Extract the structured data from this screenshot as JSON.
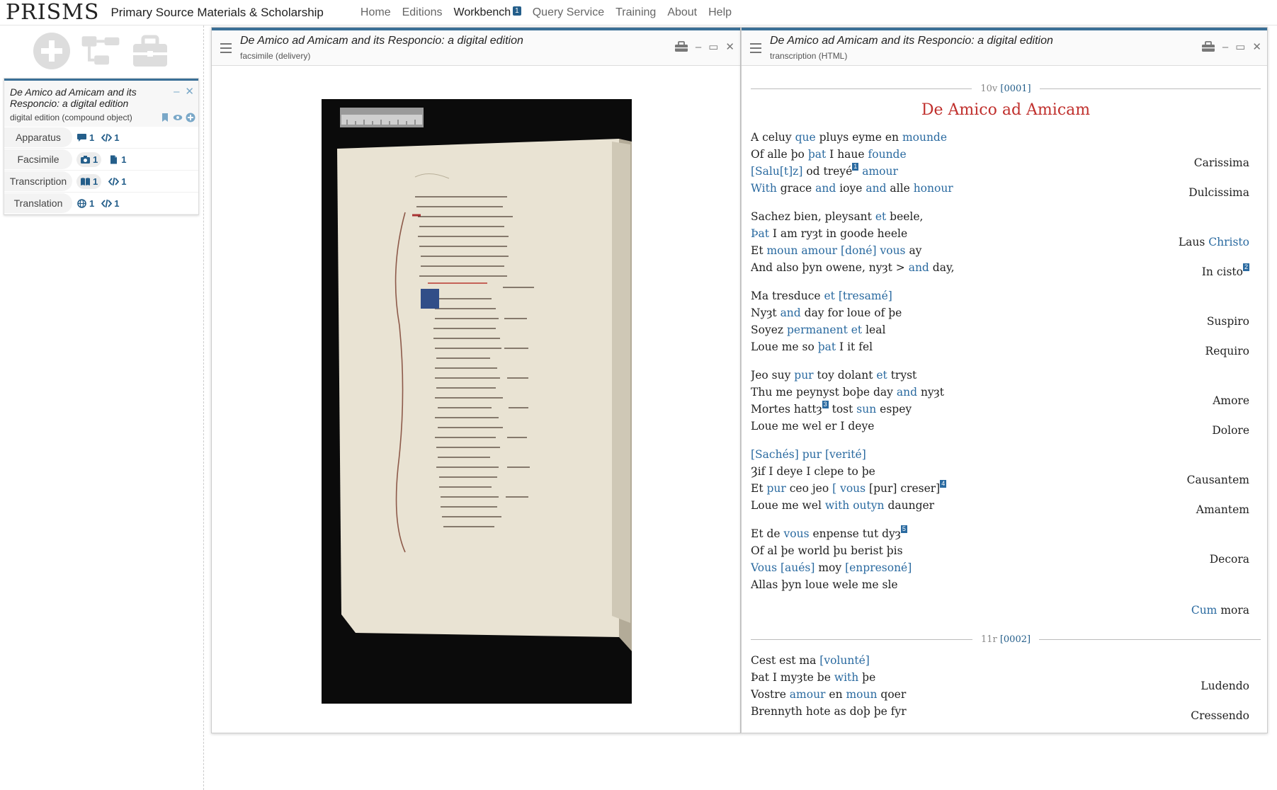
{
  "brand": {
    "logo": "PRISMS",
    "tagline": "Primary Source Materials & Scholarship"
  },
  "nav": [
    {
      "label": "Home",
      "active": false
    },
    {
      "label": "Editions",
      "active": false
    },
    {
      "label": "Workbench",
      "active": true,
      "badge": "1"
    },
    {
      "label": "Query Service",
      "active": false
    },
    {
      "label": "Training",
      "active": false
    },
    {
      "label": "About",
      "active": false
    },
    {
      "label": "Help",
      "active": false
    }
  ],
  "tools": [
    "add-icon",
    "tree-icon",
    "toolbox-icon"
  ],
  "object_card": {
    "title": "De Amico ad Amicam and its Responcio: a digital edition",
    "subtitle": "digital edition (compound object)",
    "components": [
      {
        "label": "Apparatus",
        "a": "1",
        "b": "1",
        "icon_a": "comment-icon",
        "icon_b": "code-icon"
      },
      {
        "label": "Facsimile",
        "a": "1",
        "b": "1",
        "icon_a": "camera-icon",
        "icon_b": "file-icon"
      },
      {
        "label": "Transcription",
        "a": "1",
        "b": "1",
        "icon_a": "book-icon",
        "icon_b": "code-icon"
      },
      {
        "label": "Translation",
        "a": "1",
        "b": "1",
        "icon_a": "globe-icon",
        "icon_b": "code-icon"
      }
    ]
  },
  "windows": {
    "facsimile": {
      "title": "De Amico ad Amicam and its Responcio: a digital edition",
      "subtitle": "facsimile (delivery)"
    },
    "transcription": {
      "title": "De Amico ad Amicam and its Responcio: a digital edition",
      "subtitle": "transcription (HTML)"
    }
  },
  "transcription": {
    "folio1": {
      "page": "10v",
      "ref": "[0001]"
    },
    "title": "De Amico ad Amicam",
    "folio2": {
      "page": "11r",
      "ref": "[0002]"
    },
    "end_gloss": {
      "blue": "Cum",
      "plain": " mora"
    }
  }
}
